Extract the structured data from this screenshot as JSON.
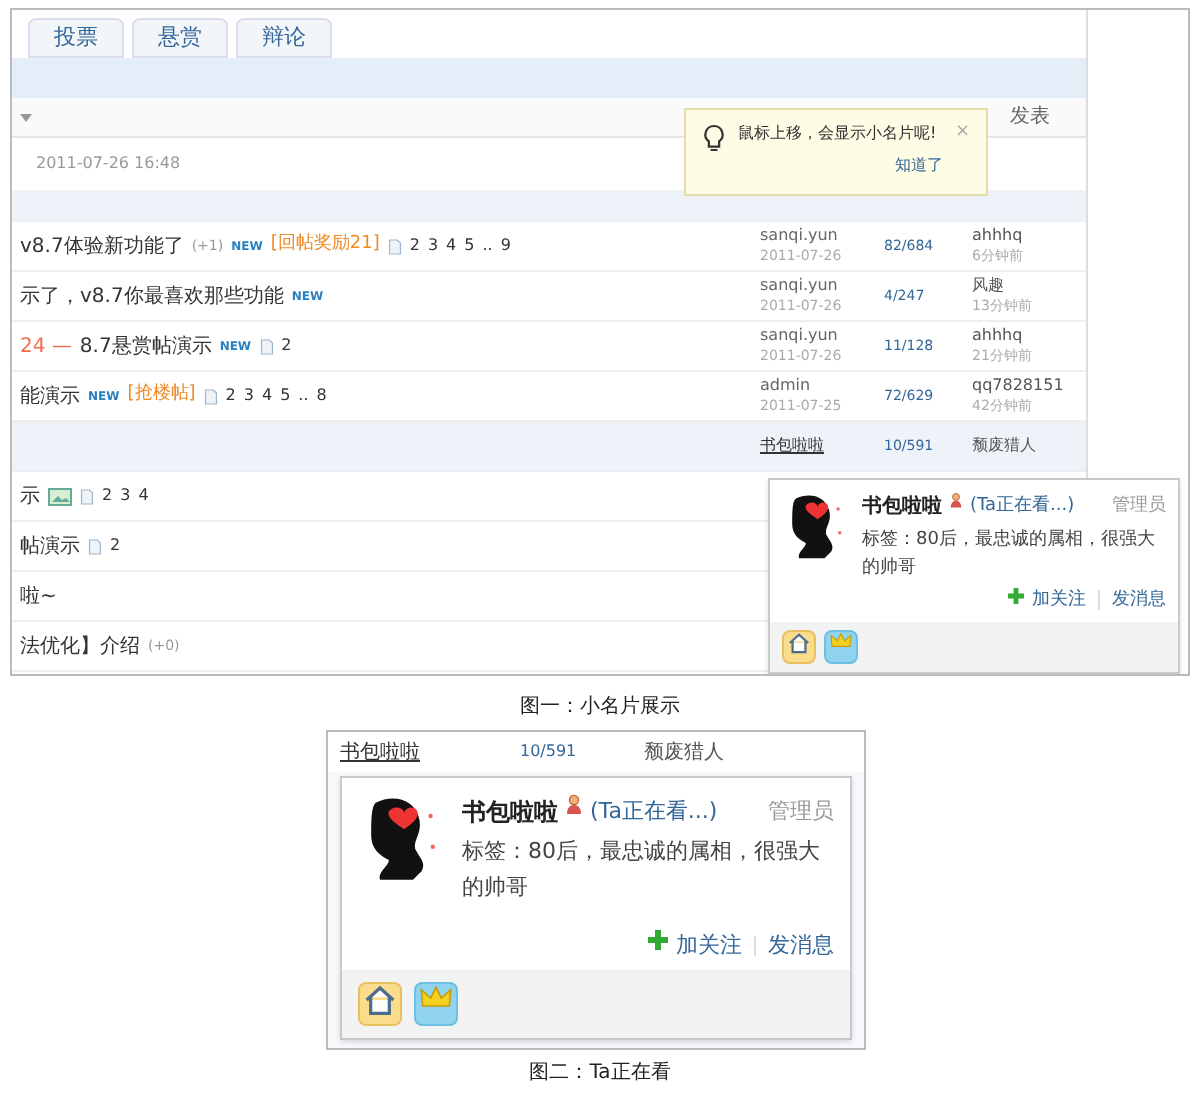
{
  "figure_1": {
    "tabs": [
      {
        "label": "投票",
        "selected": false
      },
      {
        "label": "悬赏",
        "selected": false
      },
      {
        "label": "辩论",
        "selected": false
      }
    ],
    "header": {
      "column_5": "发表"
    },
    "pinned_row": {
      "date": "2011-07-26 16:48"
    },
    "tooltip": {
      "text": "鼠标上移，会显示小名片呢!",
      "link": "知道了",
      "close": "×"
    },
    "threads": [
      {
        "title": "v8.7体验新功能了",
        "extra": "(+1)",
        "badge": "NEW",
        "tag": "[回帖奖励21]",
        "pages": [
          "2",
          "3",
          "4",
          "5",
          "..",
          "9"
        ],
        "author": "sanqi.yun",
        "date": "2011-07-26",
        "counts": "82/684",
        "last_poster": "ahhhq",
        "last_time": "6分钟前"
      },
      {
        "title": "示了，v8.7你最喜欢那些功能",
        "badge": "NEW",
        "author": "sanqi.yun",
        "date": "2011-07-26",
        "counts": "4/247",
        "last_poster": "风趣",
        "last_time": "13分钟前"
      },
      {
        "prefix": "24 —",
        "title": "8.7悬赏帖演示",
        "badge": "NEW",
        "pages": [
          "2"
        ],
        "author": "sanqi.yun",
        "date": "2011-07-26",
        "counts": "11/128",
        "last_poster": "ahhhq",
        "last_time": "21分钟前"
      },
      {
        "title": "能演示",
        "badge": "NEW",
        "tag": "[抢楼帖]",
        "pages": [
          "2",
          "3",
          "4",
          "5",
          "..",
          "8"
        ],
        "author": "admin",
        "date": "2011-07-25",
        "counts": "72/629",
        "last_poster": "qq7828151",
        "last_time": "42分钟前"
      },
      {
        "highlighted": true,
        "author": "书包啦啦",
        "counts": "10/591",
        "last_poster": "颓废猎人"
      },
      {
        "title": "示",
        "image": true,
        "pages": [
          "2",
          "3",
          "4"
        ]
      },
      {
        "title": "帖演示",
        "pages": [
          "2"
        ]
      },
      {
        "title": "啦~"
      },
      {
        "title": "法优化】介绍",
        "extra": "(+0)"
      }
    ],
    "card": {
      "name": "书包啦啦",
      "status": "(Ta正在看...)",
      "role": "管理员",
      "tags": "标签：80后，最忠诚的属相，很强大的帅哥",
      "follow": "加关注",
      "message": "发消息"
    },
    "caption": "图一：小名片展示"
  },
  "figure_2": {
    "row": {
      "author": "书包啦啦",
      "counts": "10/591",
      "last_poster": "颓废猎人"
    },
    "card": {
      "name": "书包啦啦",
      "status": "(Ta正在看...)",
      "role": "管理员",
      "tags": "标签：80后，最忠诚的属相，很强大的帅哥",
      "follow": "加关注",
      "message": "发消息"
    },
    "caption": "图二：Ta正在看"
  }
}
